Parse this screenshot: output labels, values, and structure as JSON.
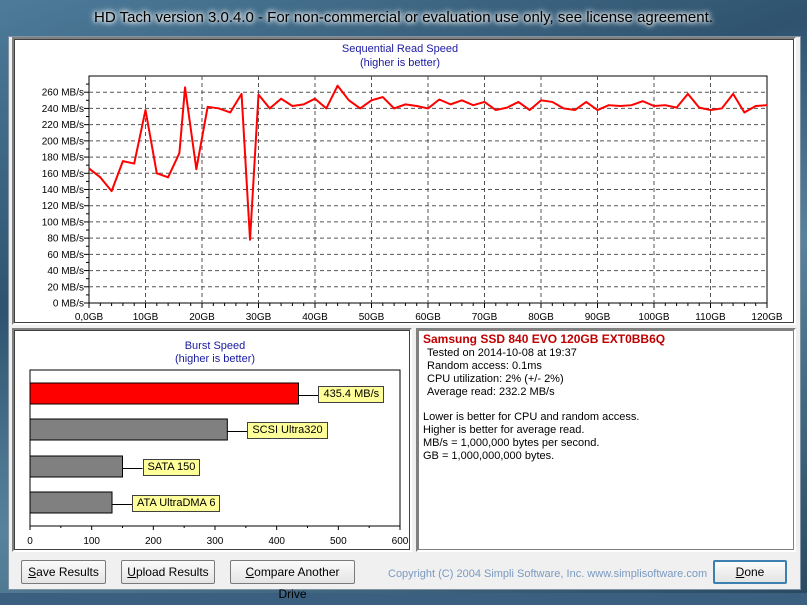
{
  "window": {
    "title": "HD Tach version 3.0.4.0  - For non-commercial or evaluation use only, see license agreement."
  },
  "chart_data": [
    {
      "type": "line",
      "title": "Sequential Read Speed",
      "subtitle": "(higher is better)",
      "ylim": [
        0,
        280
      ],
      "y_ticks": [
        "0 MB/s",
        "20 MB/s",
        "40 MB/s",
        "60 MB/s",
        "80 MB/s",
        "100 MB/s",
        "120 MB/s",
        "140 MB/s",
        "160 MB/s",
        "180 MB/s",
        "200 MB/s",
        "220 MB/s",
        "240 MB/s",
        "260 MB/s"
      ],
      "x_ticks": [
        "0,0GB",
        "10GB",
        "20GB",
        "30GB",
        "40GB",
        "50GB",
        "60GB",
        "70GB",
        "80GB",
        "90GB",
        "100GB",
        "110GB",
        "120GB"
      ],
      "xlim": [
        0,
        120
      ],
      "grid": true,
      "series": [
        {
          "color": "#ff0000",
          "x": [
            0,
            2,
            4,
            6,
            8,
            10,
            12,
            14,
            16,
            17,
            19,
            21,
            23,
            25,
            27,
            28.5,
            30,
            32,
            34,
            36,
            38,
            40,
            42,
            44,
            46,
            48,
            50,
            52,
            54,
            56,
            58,
            60,
            62,
            64,
            66,
            68,
            70,
            72,
            74,
            76,
            78,
            80,
            82,
            84,
            86,
            88,
            90,
            92,
            94,
            96,
            98,
            100,
            102,
            104,
            106,
            108,
            110,
            112,
            114,
            116,
            118,
            120
          ],
          "y": [
            166,
            155,
            138,
            175,
            172,
            238,
            160,
            155,
            185,
            266,
            165,
            242,
            240,
            235,
            258,
            78,
            257,
            240,
            252,
            243,
            245,
            252,
            240,
            268,
            250,
            240,
            250,
            254,
            240,
            245,
            243,
            240,
            251,
            245,
            250,
            244,
            248,
            238,
            241,
            248,
            238,
            250,
            248,
            240,
            238,
            248,
            238,
            244,
            243,
            244,
            249,
            243,
            244,
            241,
            258,
            241,
            238,
            240,
            258,
            235,
            243,
            244
          ]
        }
      ]
    },
    {
      "type": "bar",
      "orientation": "horizontal",
      "title": "Burst Speed",
      "subtitle": "(higher is better)",
      "xlim": [
        0,
        600
      ],
      "x_ticks": [
        "0",
        "100",
        "200",
        "300",
        "400",
        "500",
        "600"
      ],
      "categories": [
        "435.4 MB/s",
        "SCSI Ultra320",
        "SATA 150",
        "ATA UltraDMA 6"
      ],
      "values": [
        435.4,
        320,
        150,
        133
      ],
      "colors": [
        "#ff0000",
        "#808080",
        "#808080",
        "#808080"
      ]
    }
  ],
  "info": {
    "drive": "Samsung SSD 840 EVO 120GB EXT0BB6Q",
    "lines": [
      "Tested on 2014-10-08 at 19:37",
      "Random access: 0.1ms",
      "CPU utilization: 2% (+/- 2%)",
      "Average read: 232.2 MB/s"
    ],
    "notes": [
      "Lower is better for CPU and random access.",
      "Higher is better for average read.",
      "MB/s = 1,000,000 bytes per second.",
      "GB = 1,000,000,000 bytes."
    ]
  },
  "buttons": {
    "save": {
      "hot": "S",
      "rest": "ave Results"
    },
    "upload": {
      "hot": "U",
      "rest": "pload Results"
    },
    "compare": {
      "hot": "C",
      "rest": "ompare Another Drive"
    },
    "done": {
      "hot": "D",
      "rest": "one"
    }
  },
  "copyright": "Copyright (C) 2004 Simpli Software, Inc. www.simplisoftware.com"
}
